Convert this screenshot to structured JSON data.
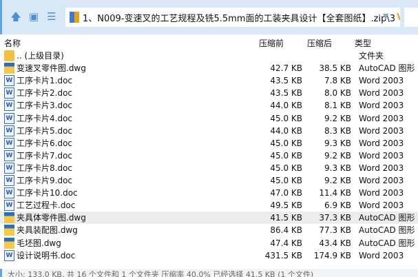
{
  "toolbar": {
    "path": "1、N009-变速叉的工艺规程及铣5.5mm面的工装夹具设计【全套图纸】.zip\\3",
    "badge": "V"
  },
  "columns": {
    "name": "名称",
    "before": "压缩前",
    "after": "压缩后",
    "type": "类型"
  },
  "files": [
    {
      "name": ".. (上级目录)",
      "before": "",
      "after": "",
      "type": "文件夹",
      "icon": "folder"
    },
    {
      "name": "变速叉零件图.dwg",
      "before": "42.7 KB",
      "after": "38.5 KB",
      "type": "AutoCAD 图形",
      "icon": "dwg"
    },
    {
      "name": "工序卡片1.doc",
      "before": "43.5 KB",
      "after": "7.8 KB",
      "type": "Word 2003",
      "icon": "doc"
    },
    {
      "name": "工序卡片2.doc",
      "before": "43.5 KB",
      "after": "8.0 KB",
      "type": "Word 2003",
      "icon": "doc"
    },
    {
      "name": "工序卡片3.doc",
      "before": "44.0 KB",
      "after": "8.1 KB",
      "type": "Word 2003",
      "icon": "doc"
    },
    {
      "name": "工序卡片4.doc",
      "before": "45.0 KB",
      "after": "9.2 KB",
      "type": "Word 2003",
      "icon": "doc"
    },
    {
      "name": "工序卡片5.doc",
      "before": "44.0 KB",
      "after": "8.3 KB",
      "type": "Word 2003",
      "icon": "doc"
    },
    {
      "name": "工序卡片6.doc",
      "before": "45.0 KB",
      "after": "9.3 KB",
      "type": "Word 2003",
      "icon": "doc"
    },
    {
      "name": "工序卡片7.doc",
      "before": "45.0 KB",
      "after": "9.2 KB",
      "type": "Word 2003",
      "icon": "doc"
    },
    {
      "name": "工序卡片8.doc",
      "before": "45.0 KB",
      "after": "9.3 KB",
      "type": "Word 2003",
      "icon": "doc"
    },
    {
      "name": "工序卡片9.doc",
      "before": "45.0 KB",
      "after": "9.2 KB",
      "type": "Word 2003",
      "icon": "doc"
    },
    {
      "name": "工序卡片10.doc",
      "before": "47.0 KB",
      "after": "11.4 KB",
      "type": "Word 2003",
      "icon": "doc"
    },
    {
      "name": "工艺过程卡.doc",
      "before": "49.5 KB",
      "after": "6.9 KB",
      "type": "Word 2003",
      "icon": "doc"
    },
    {
      "name": "夹具体零件图.dwg",
      "before": "41.5 KB",
      "after": "37.3 KB",
      "type": "AutoCAD 图形",
      "icon": "dwg",
      "selected": true
    },
    {
      "name": "夹具装配图.dwg",
      "before": "86.4 KB",
      "after": "77.3 KB",
      "type": "AutoCAD 图形",
      "icon": "dwg"
    },
    {
      "name": "毛坯图.dwg",
      "before": "47.4 KB",
      "after": "43.4 KB",
      "type": "AutoCAD 图形",
      "icon": "dwg"
    },
    {
      "name": "设计说明书.doc",
      "before": "431.5 KB",
      "after": "174.9 KB",
      "type": "Word 2003",
      "icon": "doc"
    }
  ],
  "status": "大小: 133.0 KB, 共 16 个文件和 1 个文件夹 压缩率 40.0% 已经选择 41.5 KB (1 个文件)"
}
